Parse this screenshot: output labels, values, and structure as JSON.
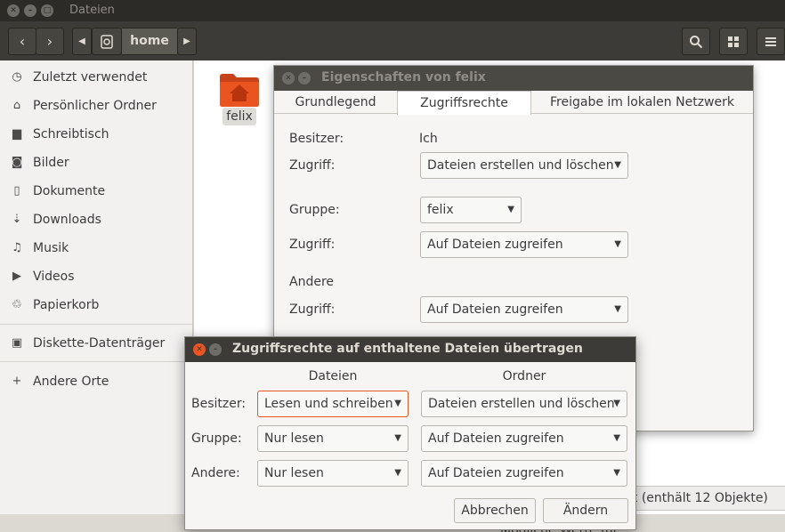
{
  "window": {
    "title": "Dateien",
    "path_label": "home"
  },
  "sidebar": {
    "items": [
      {
        "label": "Zuletzt verwendet",
        "icon": "clock-icon"
      },
      {
        "label": "Persönlicher Ordner",
        "icon": "home-icon"
      },
      {
        "label": "Schreibtisch",
        "icon": "folder-icon"
      },
      {
        "label": "Bilder",
        "icon": "camera-icon"
      },
      {
        "label": "Dokumente",
        "icon": "document-icon"
      },
      {
        "label": "Downloads",
        "icon": "download-icon"
      },
      {
        "label": "Musik",
        "icon": "music-icon"
      },
      {
        "label": "Videos",
        "icon": "video-icon"
      },
      {
        "label": "Papierkorb",
        "icon": "trash-icon"
      }
    ],
    "devices": [
      {
        "label": "Diskette-Datenträger",
        "icon": "floppy-icon"
      }
    ],
    "other": {
      "label": "Andere Orte",
      "icon": "plus-icon"
    }
  },
  "content": {
    "folder_name": "felix",
    "status_text": "lt  (enthält 12 Objekte)",
    "bottom_text": "Mögliche Werte für:"
  },
  "properties": {
    "title": "Eigenschaften von felix",
    "tabs": [
      "Grundlegend",
      "Zugriffsrechte",
      "Freigabe im lokalen Netzwerk"
    ],
    "active_tab": 1,
    "owner_label": "Besitzer:",
    "owner_value": "Ich",
    "owner_access_label": "Zugriff:",
    "owner_access_value": "Dateien erstellen und löschen",
    "group_label": "Gruppe:",
    "group_value": "felix",
    "group_access_label": "Zugriff:",
    "group_access_value": "Auf Dateien zugreifen",
    "others_label": "Andere",
    "others_access_label": "Zugriff:",
    "others_access_value": "Auf Dateien zugreifen"
  },
  "apply_dialog": {
    "title": "Zugriffsrechte auf enthaltene Dateien übertragen",
    "col_files": "Dateien",
    "col_folders": "Ordner",
    "rows": [
      {
        "label": "Besitzer:",
        "files": "Lesen und schreiben",
        "folders": "Dateien erstellen und löschen"
      },
      {
        "label": "Gruppe:",
        "files": "Nur lesen",
        "folders": "Auf Dateien zugreifen"
      },
      {
        "label": "Andere:",
        "files": "Nur lesen",
        "folders": "Auf Dateien zugreifen"
      }
    ],
    "cancel_label": "Abbrechen",
    "apply_label": "Ändern"
  },
  "colors": {
    "accent": "#e95420",
    "titlebar": "#2c2b28",
    "toolbar": "#3c3b37",
    "sidebar": "#f2f1f0"
  }
}
